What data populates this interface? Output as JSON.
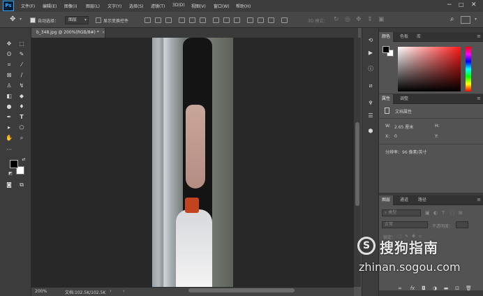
{
  "app": {
    "logo": "Ps"
  },
  "menu": [
    "文件(F)",
    "编辑(E)",
    "图像(I)",
    "图层(L)",
    "文字(Y)",
    "选择(S)",
    "滤镜(T)",
    "3D(D)",
    "视图(V)",
    "窗口(W)",
    "帮助(H)"
  ],
  "options": {
    "auto_select_label": "自动选择：",
    "auto_select_value": "图层",
    "show_transform_label": "显示变换控件",
    "mode_3d_label": "3D 模式："
  },
  "document": {
    "tab_title": "b_348.jpg @ 200%(RGB/8#) *"
  },
  "status": {
    "zoom": "200%",
    "doc_info": "文档:102.5K/102.5K"
  },
  "panels": {
    "color_tabs": [
      "颜色",
      "色板",
      "库"
    ],
    "properties_tabs": [
      "属性",
      "调整"
    ],
    "properties_title": "文档属性",
    "w_label": "W:",
    "w_value": "2.65 厘米",
    "h_label": "H:",
    "x_label": "X:",
    "x_value": "0",
    "y_label": "Y:",
    "resolution": "分辨率：96 像素/英寸",
    "layers_tabs": [
      "图层",
      "通道",
      "路径"
    ],
    "layer_filter": "类型",
    "blend_mode": "正常",
    "opacity_label": "不透明度：",
    "lock_label": "锁定："
  },
  "watermark": {
    "cn": "搜狗指南",
    "en": "zhinan.sogou.com"
  },
  "colors": {
    "foreground": "#000000",
    "background": "#ffffff",
    "ps_blue": "#31a8ff"
  }
}
